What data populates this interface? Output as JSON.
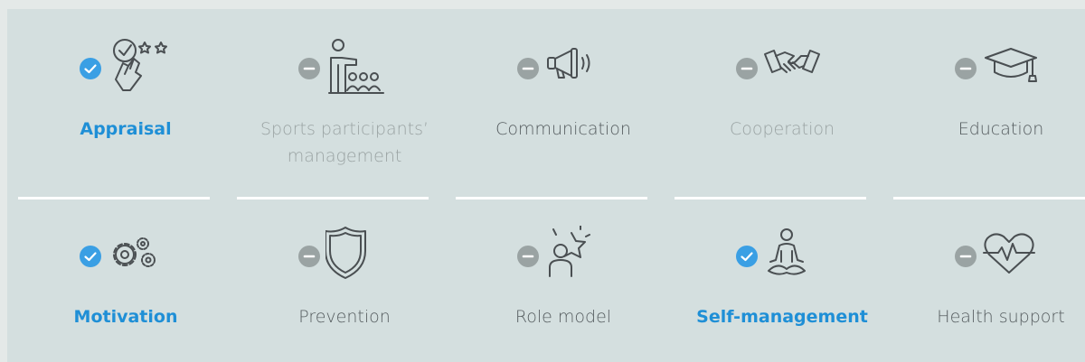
{
  "colors": {
    "selected": "#1f8fd6",
    "status_on": "#3a9fe4",
    "status_off": "#9aa3a3",
    "text_dim": "#9aa3a3",
    "text_plain": "#555c5f"
  },
  "items": [
    {
      "label": "Appraisal",
      "selected": true,
      "icon": "appraisal-icon"
    },
    {
      "label": "Sports participants’ management",
      "selected": false,
      "icon": "presenter-icon"
    },
    {
      "label": "Communication",
      "selected": false,
      "icon": "megaphone-icon"
    },
    {
      "label": "Cooperation",
      "selected": false,
      "icon": "handshake-icon"
    },
    {
      "label": "Education",
      "selected": false,
      "icon": "graduation-cap-icon"
    },
    {
      "label": "Motivation",
      "selected": true,
      "icon": "gears-icon"
    },
    {
      "label": "Prevention",
      "selected": false,
      "icon": "shield-icon"
    },
    {
      "label": "Role model",
      "selected": false,
      "icon": "star-person-icon"
    },
    {
      "label": "Self-management",
      "selected": true,
      "icon": "meditation-icon"
    },
    {
      "label": "Health support",
      "selected": false,
      "icon": "heart-pulse-icon"
    }
  ]
}
